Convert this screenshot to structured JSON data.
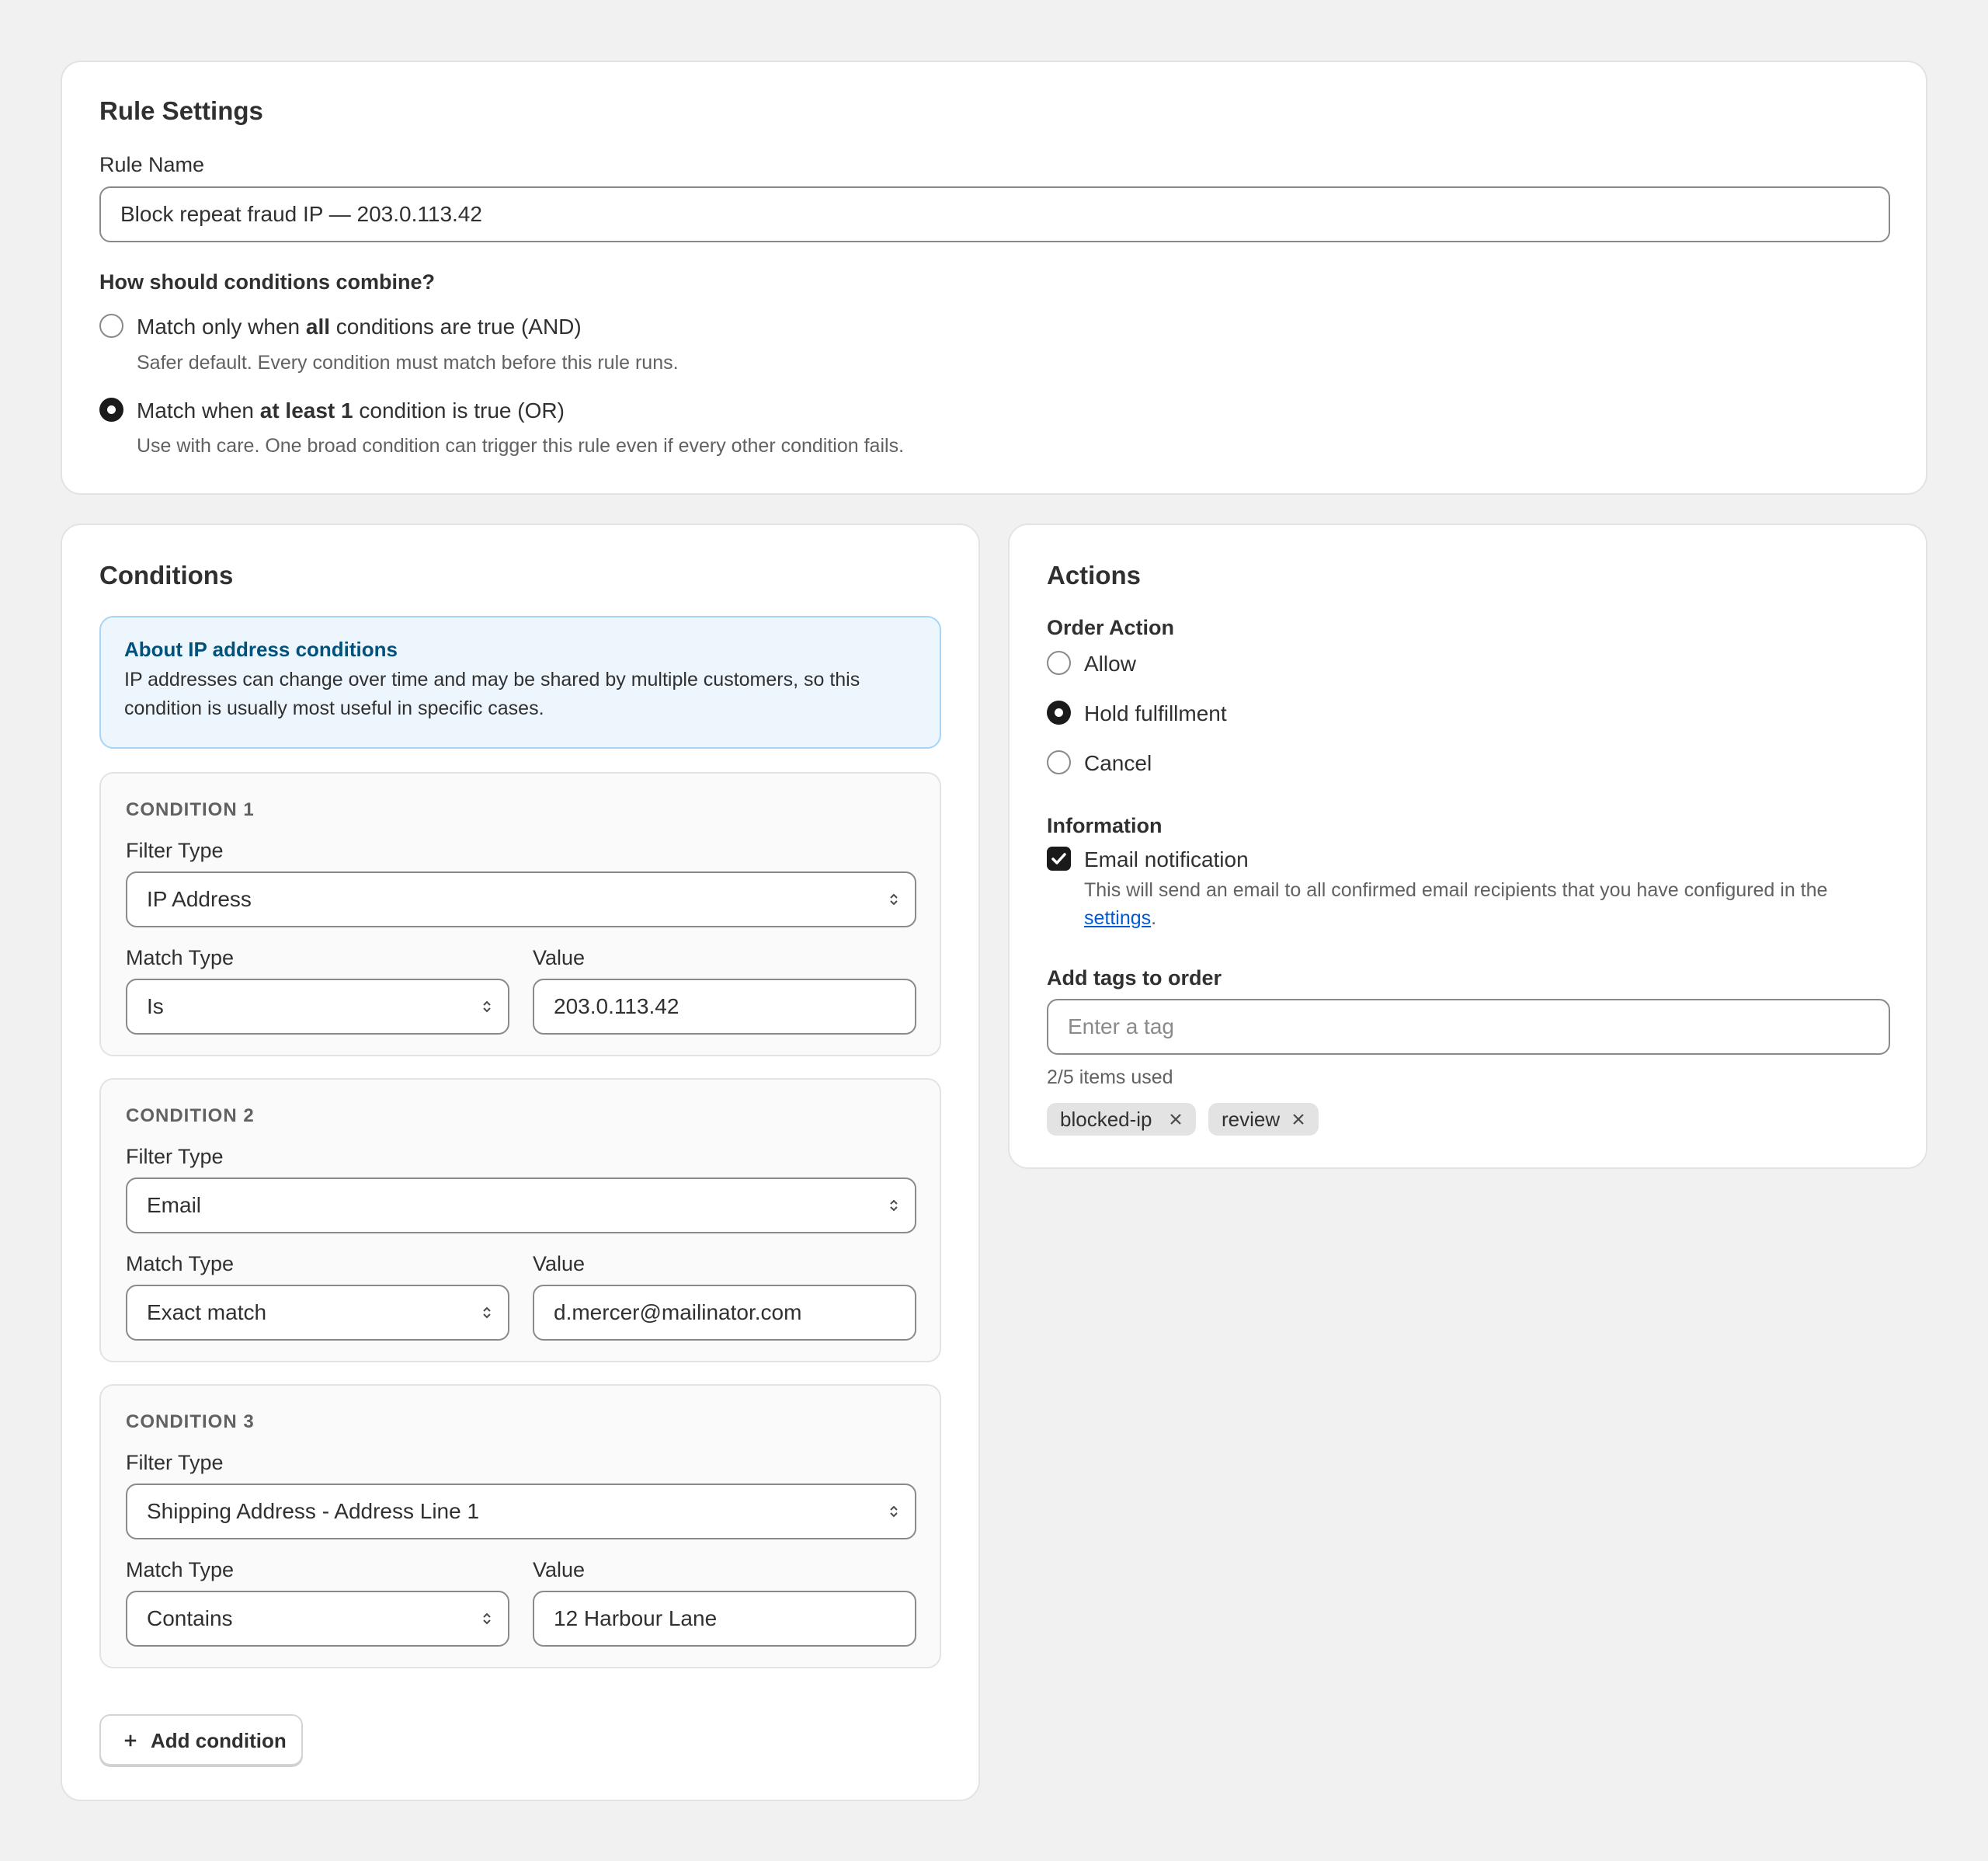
{
  "rule_settings": {
    "title": "Rule Settings",
    "rule_name_label": "Rule Name",
    "rule_name_value": "Block repeat fraud IP — 203.0.113.42",
    "combine_question": "How should conditions combine?",
    "options": [
      {
        "prefix": "Match only when ",
        "bold": "all",
        "suffix": " conditions are true (AND)",
        "help": "Safer default. Every condition must match before this rule runs.",
        "selected": false
      },
      {
        "prefix": "Match when ",
        "bold": "at least 1",
        "suffix": " condition is true (OR)",
        "help": "Use with care. One broad condition can trigger this rule even if every other condition fails.",
        "selected": true
      }
    ]
  },
  "conditions": {
    "title": "Conditions",
    "info_banner": {
      "title": "About IP address conditions",
      "body_line1": "IP addresses can change over time and may be shared by multiple customers, so this",
      "body_line2": "condition is usually most useful in specific cases."
    },
    "filter_type_label": "Filter Type",
    "match_type_label": "Match Type",
    "value_label": "Value",
    "items": [
      {
        "heading": "CONDITION 1",
        "filter_type": "IP Address",
        "match_type": "Is",
        "value": "203.0.113.42"
      },
      {
        "heading": "CONDITION 2",
        "filter_type": "Email",
        "match_type": "Exact match",
        "value": "d.mercer@mailinator.com"
      },
      {
        "heading": "CONDITION 3",
        "filter_type": "Shipping Address - Address Line 1",
        "match_type": "Contains",
        "value": "12 Harbour Lane"
      }
    ],
    "add_button_label": "Add condition"
  },
  "actions": {
    "title": "Actions",
    "order_action_label": "Order Action",
    "order_actions": [
      {
        "label": "Allow",
        "selected": false
      },
      {
        "label": "Hold fulfillment",
        "selected": true
      },
      {
        "label": "Cancel",
        "selected": false
      }
    ],
    "information_label": "Information",
    "email_notification": {
      "label": "Email notification",
      "checked": true,
      "help_line1": "This will send an email to all confirmed email recipients that you have configured in the",
      "help_link": "settings",
      "help_end": "."
    },
    "tags": {
      "label": "Add tags to order",
      "placeholder": "Enter a tag",
      "count_text": "2/5 items used",
      "items": [
        "blocked-ip",
        "review"
      ]
    }
  },
  "colors": {
    "page_bg": "#f1f1f1",
    "card_bg": "#ffffff",
    "info_bg": "#eef6fd",
    "info_title": "#00527c",
    "link": "#005bd3",
    "selected": "#1a1a1a"
  }
}
